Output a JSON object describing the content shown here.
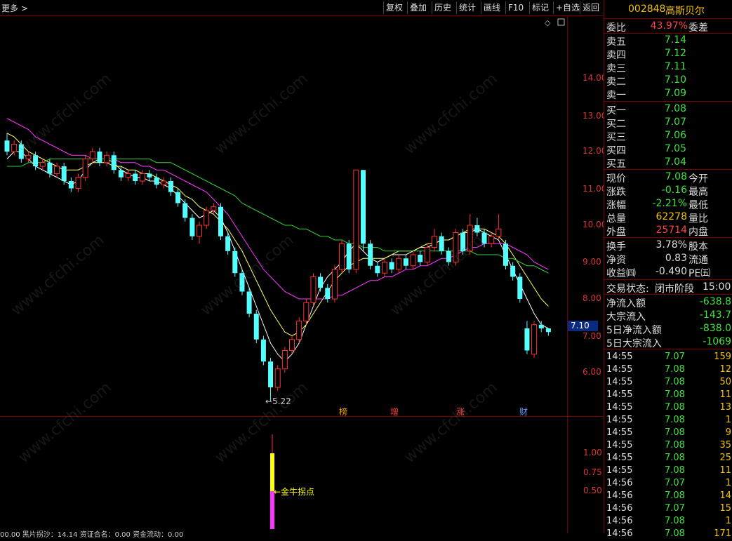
{
  "toolbar": {
    "more": "更多 >",
    "buttons": [
      "复权",
      "叠加",
      "历史",
      "统计",
      "画线",
      "F10",
      "标记",
      "+自选",
      "返回"
    ]
  },
  "watermark": "www.cfchi.com",
  "price_axis": [
    "14.00",
    "13.00",
    "12.00",
    "11.00",
    "10.00",
    "9.00",
    "8.00",
    "7.00",
    "6.00"
  ],
  "indicator_axis": [
    "1.00",
    "0.75",
    "0.50"
  ],
  "current_price_tag": "7.10",
  "low_label": "←5.22",
  "event_markers": [
    {
      "text": "榜",
      "color": "#f2a000"
    },
    {
      "text": "增",
      "color": "#ff4040"
    },
    {
      "text": "涨",
      "color": "#ff4040"
    },
    {
      "text": "财",
      "color": "#5fa0ff"
    }
  ],
  "indicator_label": "←金牛拐点",
  "bottom_status": "00.00   黑片拐沙：14.14   资证合名：0.00   资金流动：0.00",
  "colors": {
    "up": "#ff3030",
    "down": "#54ffff",
    "ma5": "#ffffff",
    "ma10": "#ffff66",
    "ma20": "#ff33ff",
    "ma60": "#33cc33"
  },
  "chart_data": {
    "type": "candlestick",
    "ylim": [
      5.0,
      15.0
    ],
    "ma_lines": [
      {
        "name": "MA5",
        "values": [
          11.8,
          12.0,
          12.0,
          11.8,
          11.6,
          11.5,
          11.4,
          11.3,
          11.2,
          11.1,
          11.2,
          11.5,
          11.7,
          11.8,
          11.8,
          11.7,
          11.5,
          11.4,
          11.3,
          11.3,
          11.2,
          11.2,
          11.1,
          11.0,
          10.8,
          10.6,
          10.4,
          10.2,
          10.3,
          10.4,
          10.2,
          9.8,
          9.3,
          8.8,
          8.3,
          7.8,
          7.3,
          6.8,
          6.5,
          6.3,
          6.5,
          6.8,
          7.3,
          7.8,
          8.3,
          8.6,
          8.8,
          9.0,
          9.3,
          9.5,
          9.3,
          9.1,
          9.0,
          9.1,
          9.2,
          9.2,
          9.2,
          9.3,
          9.4,
          9.4,
          9.5,
          9.6,
          9.6,
          9.7,
          9.8,
          9.8,
          9.9,
          9.8,
          9.7,
          9.6,
          9.2,
          8.8,
          8.4,
          8.0,
          7.6,
          7.3,
          7.2
        ]
      },
      {
        "name": "MA10",
        "values": [
          12.5,
          12.4,
          12.2,
          12.0,
          11.9,
          11.8,
          11.7,
          11.6,
          11.5,
          11.5,
          11.5,
          11.6,
          11.7,
          11.7,
          11.7,
          11.6,
          11.6,
          11.5,
          11.5,
          11.4,
          11.4,
          11.3,
          11.2,
          11.1,
          11.0,
          10.8,
          10.7,
          10.5,
          10.4,
          10.3,
          10.1,
          9.9,
          9.6,
          9.3,
          8.9,
          8.5,
          8.1,
          7.7,
          7.4,
          7.1,
          7.0,
          7.1,
          7.3,
          7.6,
          7.9,
          8.2,
          8.5,
          8.7,
          8.9,
          9.0,
          9.1,
          9.1,
          9.1,
          9.1,
          9.2,
          9.3,
          9.3,
          9.3,
          9.4,
          9.5,
          9.5,
          9.6,
          9.6,
          9.7,
          9.8,
          9.9,
          9.9,
          9.9,
          9.8,
          9.7,
          9.5,
          9.2,
          8.9,
          8.6,
          8.3,
          8.0,
          7.8
        ]
      },
      {
        "name": "MA20",
        "values": [
          12.9,
          12.8,
          12.7,
          12.6,
          12.4,
          12.3,
          12.2,
          12.1,
          12.0,
          11.9,
          11.9,
          11.9,
          11.8,
          11.8,
          11.8,
          11.8,
          11.7,
          11.7,
          11.7,
          11.6,
          11.6,
          11.5,
          11.5,
          11.4,
          11.3,
          11.2,
          11.1,
          11.0,
          10.9,
          10.7,
          10.5,
          10.3,
          10.0,
          9.7,
          9.4,
          9.1,
          8.8,
          8.6,
          8.4,
          8.2,
          8.1,
          8.0,
          8.0,
          8.0,
          8.0,
          8.0,
          8.1,
          8.1,
          8.2,
          8.3,
          8.4,
          8.5,
          8.5,
          8.6,
          8.6,
          8.7,
          8.8,
          8.8,
          8.9,
          8.9,
          9.0,
          9.1,
          9.1,
          9.2,
          9.3,
          9.4,
          9.4,
          9.5,
          9.5,
          9.5,
          9.5,
          9.4,
          9.3,
          9.2,
          9.0,
          8.9,
          8.8
        ]
      },
      {
        "name": "MA60",
        "values": [
          11.6,
          11.6,
          11.6,
          11.7,
          11.7,
          11.7,
          11.8,
          11.8,
          11.8,
          11.8,
          11.8,
          11.8,
          11.8,
          11.8,
          11.8,
          11.8,
          11.8,
          11.8,
          11.8,
          11.8,
          11.8,
          11.7,
          11.7,
          11.7,
          11.6,
          11.5,
          11.4,
          11.3,
          11.2,
          11.1,
          11.0,
          10.9,
          10.8,
          10.6,
          10.5,
          10.4,
          10.3,
          10.2,
          10.1,
          10.0,
          10.0,
          9.9,
          9.9,
          9.8,
          9.7,
          9.7,
          9.6,
          9.6,
          9.5,
          9.5,
          9.4,
          9.4,
          9.4,
          9.3,
          9.3,
          9.3,
          9.3,
          9.3,
          9.3,
          9.3,
          9.3,
          9.3,
          9.3,
          9.3,
          9.3,
          9.3,
          9.2,
          9.2,
          9.2,
          9.2,
          9.1,
          9.1,
          9.0,
          8.9,
          8.9,
          8.8,
          8.7
        ]
      }
    ],
    "candles": [
      [
        12.3,
        12.0,
        12.5,
        11.9
      ],
      [
        12.0,
        12.2,
        12.3,
        11.9
      ],
      [
        12.2,
        11.8,
        12.3,
        11.7
      ],
      [
        11.8,
        11.9,
        12.0,
        11.7
      ],
      [
        11.9,
        11.6,
        12.0,
        11.5
      ],
      [
        11.6,
        11.7,
        11.8,
        11.5
      ],
      [
        11.7,
        11.4,
        11.8,
        11.3
      ],
      [
        11.4,
        11.6,
        11.7,
        11.3
      ],
      [
        11.6,
        11.2,
        11.7,
        11.1
      ],
      [
        11.2,
        11.0,
        11.3,
        10.9
      ],
      [
        11.0,
        11.3,
        11.4,
        10.9
      ],
      [
        11.3,
        11.8,
        11.9,
        11.2
      ],
      [
        11.8,
        12.0,
        12.1,
        11.7
      ],
      [
        12.0,
        11.7,
        12.1,
        11.6
      ],
      [
        11.7,
        11.9,
        12.0,
        11.6
      ],
      [
        11.9,
        11.5,
        12.0,
        11.4
      ],
      [
        11.5,
        11.3,
        11.6,
        11.2
      ],
      [
        11.3,
        11.4,
        11.5,
        11.2
      ],
      [
        11.4,
        11.2,
        11.5,
        11.1
      ],
      [
        11.2,
        11.4,
        11.5,
        11.1
      ],
      [
        11.4,
        11.3,
        11.5,
        11.2
      ],
      [
        11.3,
        11.1,
        11.4,
        11.0
      ],
      [
        11.1,
        11.2,
        11.3,
        11.0
      ],
      [
        11.2,
        10.9,
        11.3,
        10.8
      ],
      [
        10.9,
        10.6,
        11.0,
        10.5
      ],
      [
        10.6,
        10.2,
        10.7,
        10.1
      ],
      [
        10.2,
        9.7,
        10.3,
        9.6
      ],
      [
        9.7,
        10.0,
        10.1,
        9.5
      ],
      [
        10.0,
        10.4,
        10.5,
        9.9
      ],
      [
        10.4,
        10.5,
        10.6,
        10.3
      ],
      [
        10.5,
        9.7,
        10.6,
        9.6
      ],
      [
        9.7,
        9.3,
        9.8,
        9.2
      ],
      [
        9.3,
        8.7,
        9.4,
        8.6
      ],
      [
        8.7,
        8.2,
        8.8,
        8.1
      ],
      [
        8.2,
        7.6,
        8.3,
        7.5
      ],
      [
        7.6,
        6.9,
        7.7,
        6.8
      ],
      [
        6.9,
        6.3,
        7.0,
        6.2
      ],
      [
        6.3,
        5.6,
        6.4,
        5.22
      ],
      [
        5.6,
        6.1,
        6.2,
        5.5
      ],
      [
        6.1,
        6.6,
        6.7,
        6.0
      ],
      [
        6.6,
        6.9,
        7.0,
        6.5
      ],
      [
        6.9,
        7.4,
        7.5,
        6.8
      ],
      [
        7.4,
        7.9,
        8.0,
        7.3
      ],
      [
        7.9,
        8.6,
        8.7,
        7.8
      ],
      [
        8.6,
        8.3,
        8.7,
        8.2
      ],
      [
        8.3,
        8.0,
        8.4,
        7.9
      ],
      [
        8.0,
        8.8,
        8.9,
        7.9
      ],
      [
        8.8,
        9.5,
        9.6,
        8.7
      ],
      [
        9.5,
        8.8,
        9.6,
        8.7
      ],
      [
        8.8,
        11.5,
        11.5,
        8.7
      ],
      [
        11.5,
        9.5,
        11.5,
        9.3
      ],
      [
        9.5,
        8.9,
        9.6,
        8.8
      ],
      [
        8.9,
        8.7,
        9.0,
        8.6
      ],
      [
        8.7,
        9.0,
        9.1,
        8.6
      ],
      [
        9.0,
        8.8,
        9.1,
        8.7
      ],
      [
        8.8,
        9.1,
        9.2,
        8.7
      ],
      [
        9.1,
        8.9,
        9.2,
        8.8
      ],
      [
        8.9,
        9.2,
        9.3,
        8.8
      ],
      [
        9.2,
        9.0,
        9.3,
        8.9
      ],
      [
        9.0,
        9.4,
        9.5,
        8.9
      ],
      [
        9.4,
        9.7,
        9.9,
        9.3
      ],
      [
        9.7,
        9.3,
        9.8,
        9.2
      ],
      [
        9.3,
        9.0,
        9.4,
        8.9
      ],
      [
        9.0,
        9.8,
        9.9,
        8.9
      ],
      [
        9.8,
        9.3,
        9.9,
        9.2
      ],
      [
        9.3,
        10.0,
        10.3,
        9.2
      ],
      [
        10.0,
        9.8,
        10.2,
        9.7
      ],
      [
        9.8,
        9.5,
        9.9,
        9.4
      ],
      [
        9.5,
        9.7,
        9.8,
        9.4
      ],
      [
        9.7,
        9.9,
        10.3,
        9.6
      ],
      [
        9.5,
        8.9,
        9.6,
        8.8
      ],
      [
        8.9,
        8.6,
        9.0,
        8.5
      ],
      [
        8.6,
        8.0,
        8.7,
        7.9
      ],
      [
        7.2,
        6.6,
        7.4,
        6.5
      ],
      [
        6.5,
        7.3,
        7.4,
        6.4
      ],
      [
        7.3,
        7.2,
        7.4,
        7.1
      ],
      [
        7.2,
        7.1,
        7.2,
        7.0
      ]
    ],
    "indicator": {
      "ylim": [
        0,
        1.25
      ],
      "segments": [
        {
          "from": 0.0,
          "to": 0.5,
          "color": "#ff33ff"
        },
        {
          "from": 0.5,
          "to": 1.0,
          "color": "#ffff00"
        }
      ],
      "line_top": 1.25
    }
  },
  "panel": {
    "code": "002848",
    "name": "高斯贝尔",
    "webi": {
      "label": "委比",
      "value": "43.97%",
      "label2": "委差"
    },
    "asks": [
      {
        "label": "卖五",
        "price": "7.14"
      },
      {
        "label": "卖四",
        "price": "7.12"
      },
      {
        "label": "卖三",
        "price": "7.11"
      },
      {
        "label": "卖二",
        "price": "7.10"
      },
      {
        "label": "卖一",
        "price": "7.09"
      }
    ],
    "bids": [
      {
        "label": "买一",
        "price": "7.08"
      },
      {
        "label": "买二",
        "price": "7.07"
      },
      {
        "label": "买三",
        "price": "7.06"
      },
      {
        "label": "买四",
        "price": "7.05"
      },
      {
        "label": "买五",
        "price": "7.04"
      }
    ],
    "stats1": [
      {
        "label": "现价",
        "value": "7.08",
        "label2": "今开",
        "color": "green"
      },
      {
        "label": "涨跌",
        "value": "-0.16",
        "label2": "最高",
        "color": "green"
      },
      {
        "label": "涨幅",
        "value": "-2.21%",
        "label2": "最低",
        "color": "green"
      },
      {
        "label": "总量",
        "value": "62278",
        "label2": "量比",
        "color": "yellow"
      },
      {
        "label": "外盘",
        "value": "25714",
        "label2": "内盘",
        "color": "red"
      }
    ],
    "stats2": [
      {
        "label": "换手",
        "value": "3.78%",
        "label2": "股本"
      },
      {
        "label": "净资",
        "value": "0.83",
        "label2": "流通"
      },
      {
        "label": "收益㈣",
        "value": "-0.490",
        "label2": "PE㈤"
      }
    ],
    "trade_status": {
      "label": "交易状态:",
      "value": "闭市阶段",
      "time": "15:00:"
    },
    "flows": [
      {
        "label": "净流入额",
        "value": "-638.8"
      },
      {
        "label": "大宗流入",
        "value": "-143.7"
      },
      {
        "label": "5日净流入额",
        "value": "-838.0"
      },
      {
        "label": "5日大宗流入",
        "value": "-1069"
      }
    ],
    "ticks": [
      {
        "time": "14:55",
        "price": "7.07",
        "vol": "159"
      },
      {
        "time": "14:55",
        "price": "7.08",
        "vol": "12"
      },
      {
        "time": "14:55",
        "price": "7.08",
        "vol": "50"
      },
      {
        "time": "14:55",
        "price": "7.08",
        "vol": "11"
      },
      {
        "time": "14:55",
        "price": "7.08",
        "vol": "13"
      },
      {
        "time": "14:55",
        "price": "7.08",
        "vol": "1"
      },
      {
        "time": "14:55",
        "price": "7.08",
        "vol": "9"
      },
      {
        "time": "14:55",
        "price": "7.08",
        "vol": "35"
      },
      {
        "time": "14:55",
        "price": "7.08",
        "vol": "25"
      },
      {
        "time": "14:55",
        "price": "7.08",
        "vol": "11"
      },
      {
        "time": "14:56",
        "price": "7.07",
        "vol": "1"
      },
      {
        "time": "14:56",
        "price": "7.08",
        "vol": "14"
      },
      {
        "time": "14:56",
        "price": "7.07",
        "vol": "15"
      },
      {
        "time": "14:56",
        "price": "7.08",
        "vol": "1"
      },
      {
        "time": "14:56",
        "price": "7.08",
        "vol": "171"
      }
    ]
  }
}
